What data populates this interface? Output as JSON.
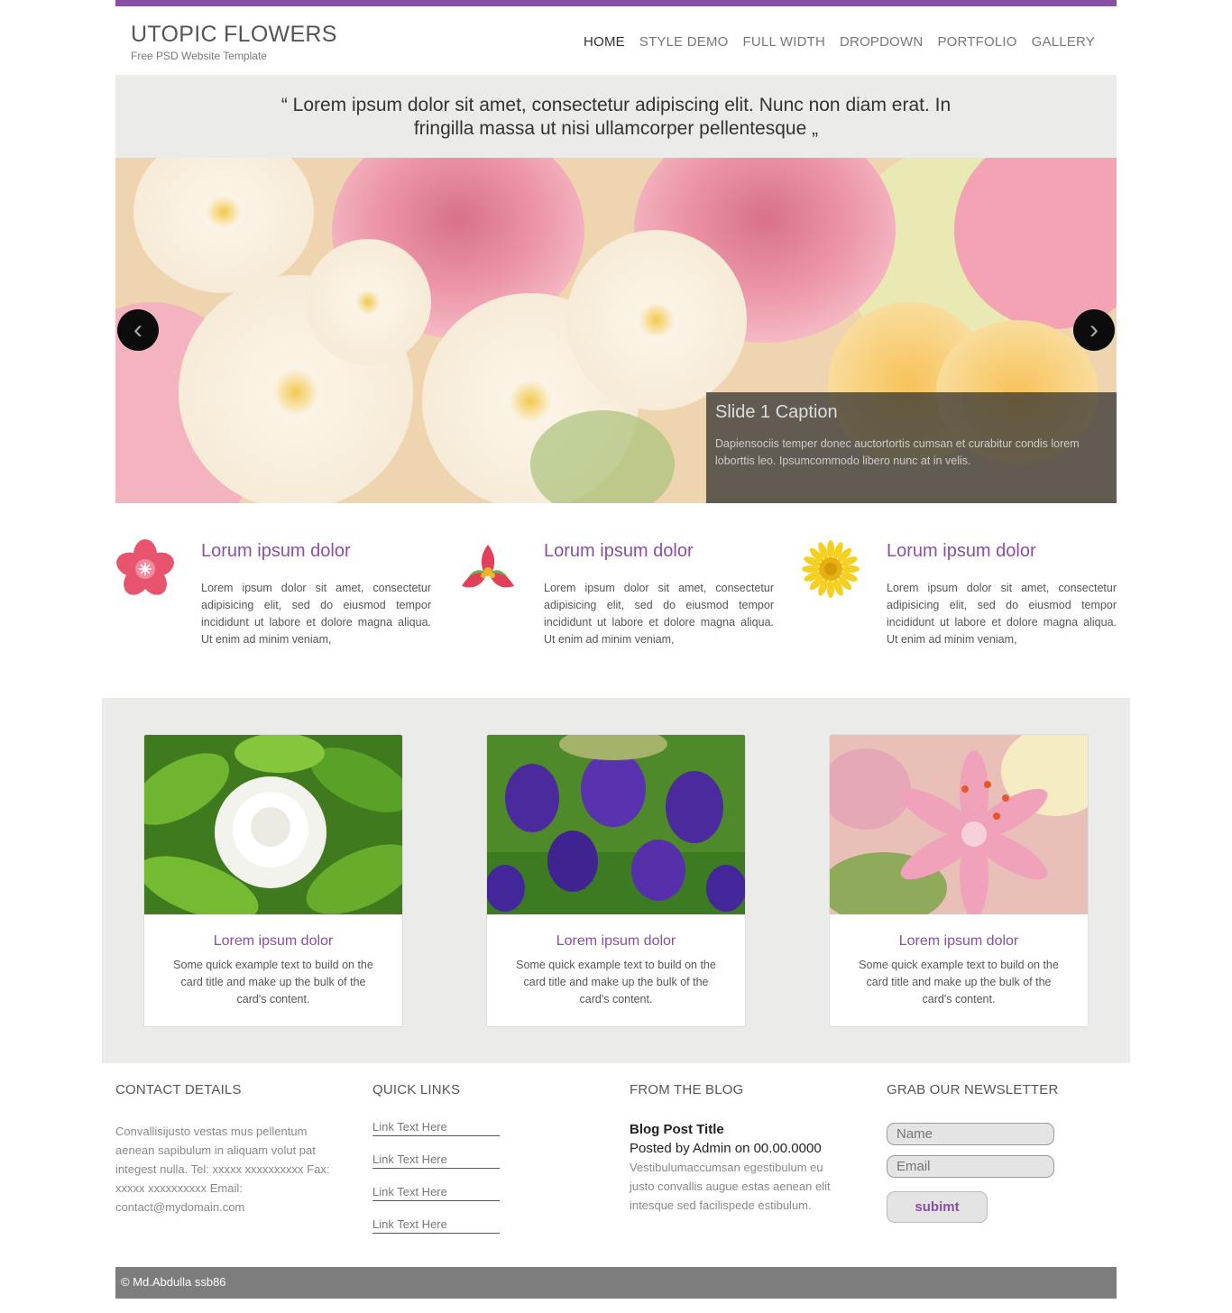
{
  "header": {
    "title": "UTOPIC FLOWERS",
    "subtitle": "Free PSD Website Template",
    "nav": [
      "HOME",
      "STYLE DEMO",
      "FULL WIDTH",
      "DROPDOWN",
      "PORTFOLIO",
      "GALLERY"
    ],
    "active_nav": "HOME"
  },
  "quote": {
    "text": "“ Lorem ipsum dolor sit amet, consectetur adipiscing elit. Nunc non diam erat. In fringilla massa ut nisi ullamcorper pellentesque „"
  },
  "slider": {
    "prev_icon": "chevron-left-icon",
    "next_icon": "chevron-right-icon",
    "caption_title": "Slide 1 Caption",
    "caption_text": "Dapiensociis temper donec auctortortis cumsan et curabitur condis lorem loborttis leo. Ipsumcommodo libero nunc at in velis."
  },
  "features": [
    {
      "icon": "pink-flower-icon",
      "title": "Lorum ipsum dolor",
      "text": "Lorem ipsum dolor sit amet, consectetur adipisicing elit, sed do eiusmod tempor incididunt ut labore et dolore magna aliqua. Ut enim ad minim veniam,"
    },
    {
      "icon": "red-flower-icon",
      "title": "Lorum ipsum dolor",
      "text": "Lorem ipsum dolor sit amet, consectetur adipisicing elit, sed do eiusmod tempor incididunt ut labore et dolore magna aliqua. Ut enim ad minim veniam,"
    },
    {
      "icon": "sunflower-icon",
      "title": "Lorum ipsum dolor",
      "text": "Lorem ipsum dolor sit amet, consectetur adipisicing elit, sed do eiusmod tempor incididunt ut labore et dolore magna aliqua. Ut enim ad minim veniam,"
    }
  ],
  "cards": [
    {
      "image": "white-gardenia-image",
      "title": "Lorem ipsum dolor",
      "text": "Some quick example text to build on the card title and make up the bulk of the card's content."
    },
    {
      "image": "purple-iris-image",
      "title": "Lorem ipsum dolor",
      "text": "Some quick example text to build on the card title and make up the bulk of the card's content."
    },
    {
      "image": "pink-lily-image",
      "title": "Lorem ipsum dolor",
      "text": "Some quick example text to build on the card title and make up the bulk of the card's content."
    }
  ],
  "footer": {
    "contact": {
      "heading": "CONTACT DETAILS",
      "text": "Convallisijusto vestas mus pellentum aenean sapibulum in aliquam volut pat integest nulla. Tel: xxxxx xxxxxxxxxx Fax: xxxxx xxxxxxxxxx Email: contact@mydomain.com"
    },
    "links": {
      "heading": "QUICK LINKS",
      "items": [
        "Link Text Here",
        "Link Text Here",
        "Link Text Here",
        "Link Text Here"
      ]
    },
    "blog": {
      "heading": "FROM THE BLOG",
      "post_title": "Blog Post Title",
      "meta": "Posted by Admin on 00.00.0000",
      "text": "Vestibulumaccumsan egestibulum eu justo convallis augue estas aenean elit intesque sed facilispede estibulum."
    },
    "newsletter": {
      "heading": "GRAB OUR NEWSLETTER",
      "name_placeholder": "Name",
      "email_placeholder": "Email",
      "button": "subimt"
    }
  },
  "copyright": "© Md.Abdulla ssb86",
  "colors": {
    "accent": "#8a4fa3",
    "band": "#ebebe9",
    "footer_bar": "#7d7d7d"
  }
}
